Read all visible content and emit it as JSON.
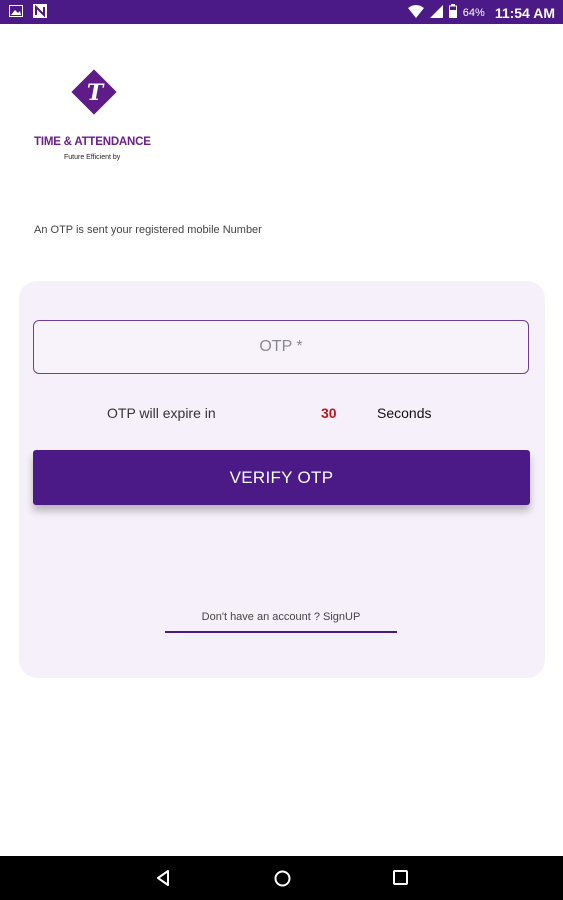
{
  "status_bar": {
    "time": "11:54 AM",
    "battery": "64%",
    "icons": [
      "image-icon",
      "n-icon",
      "wifi-icon",
      "signal-icon",
      "battery-icon"
    ]
  },
  "logo": {
    "letter": "T",
    "title": "TIME & ATTENDANCE",
    "tagline": "Future Efficient by"
  },
  "otp_sent_text": "An  OTP is sent your registered mobile Number",
  "otp_input": {
    "placeholder": "OTP *",
    "value": ""
  },
  "expire": {
    "label": "OTP will expire in",
    "count": "30",
    "unit": "Seconds"
  },
  "verify_button": "VERIFY OTP",
  "signup_link": "Don't have an account ? SignUP",
  "nav_bar": {
    "icons": [
      "back-icon",
      "home-icon",
      "recent-apps-icon"
    ]
  },
  "colors": {
    "primary": "#4b1a86",
    "card_bg": "#f6f0fa",
    "countdown": "#c0141e"
  }
}
